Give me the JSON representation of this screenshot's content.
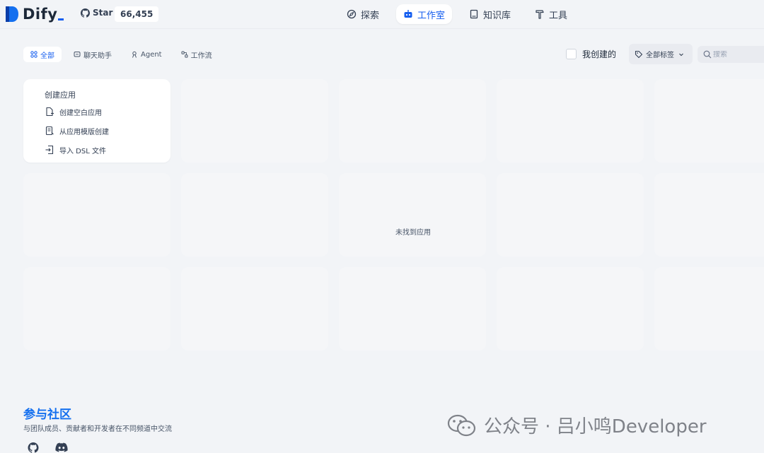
{
  "header": {
    "logo_text": "Dify",
    "star_label": "Star",
    "star_count": "66,455",
    "nav": [
      {
        "label": "探索",
        "icon": "explore-icon"
      },
      {
        "label": "工作室",
        "icon": "robot-icon",
        "active": true
      },
      {
        "label": "知识库",
        "icon": "book-icon"
      },
      {
        "label": "工具",
        "icon": "hammer-icon"
      }
    ]
  },
  "filters": {
    "tabs": [
      {
        "label": "全部",
        "icon": "grid-icon",
        "active": true
      },
      {
        "label": "聊天助手",
        "icon": "chat-icon"
      },
      {
        "label": "Agent",
        "icon": "agent-icon"
      },
      {
        "label": "工作流",
        "icon": "workflow-icon"
      }
    ],
    "mine_label": "我创建的",
    "tag_label": "全部标签",
    "search_placeholder": "搜索"
  },
  "create_card": {
    "title": "创建应用",
    "items": [
      {
        "label": "创建空白应用",
        "icon": "file-plus-icon"
      },
      {
        "label": "从应用模版创建",
        "icon": "template-icon"
      },
      {
        "label": "导入 DSL 文件",
        "icon": "import-icon"
      }
    ]
  },
  "empty_state": "未找到应用",
  "footer": {
    "title": "参与社区",
    "description": "与团队成员、贡献者和开发者在不同频道中交流",
    "social": [
      "github-icon",
      "discord-icon"
    ]
  },
  "watermark": "公众号 · 吕小鸣Developer",
  "colors": {
    "accent": "#155eef",
    "community": "#1570ef",
    "background": "#f2f4f7"
  }
}
